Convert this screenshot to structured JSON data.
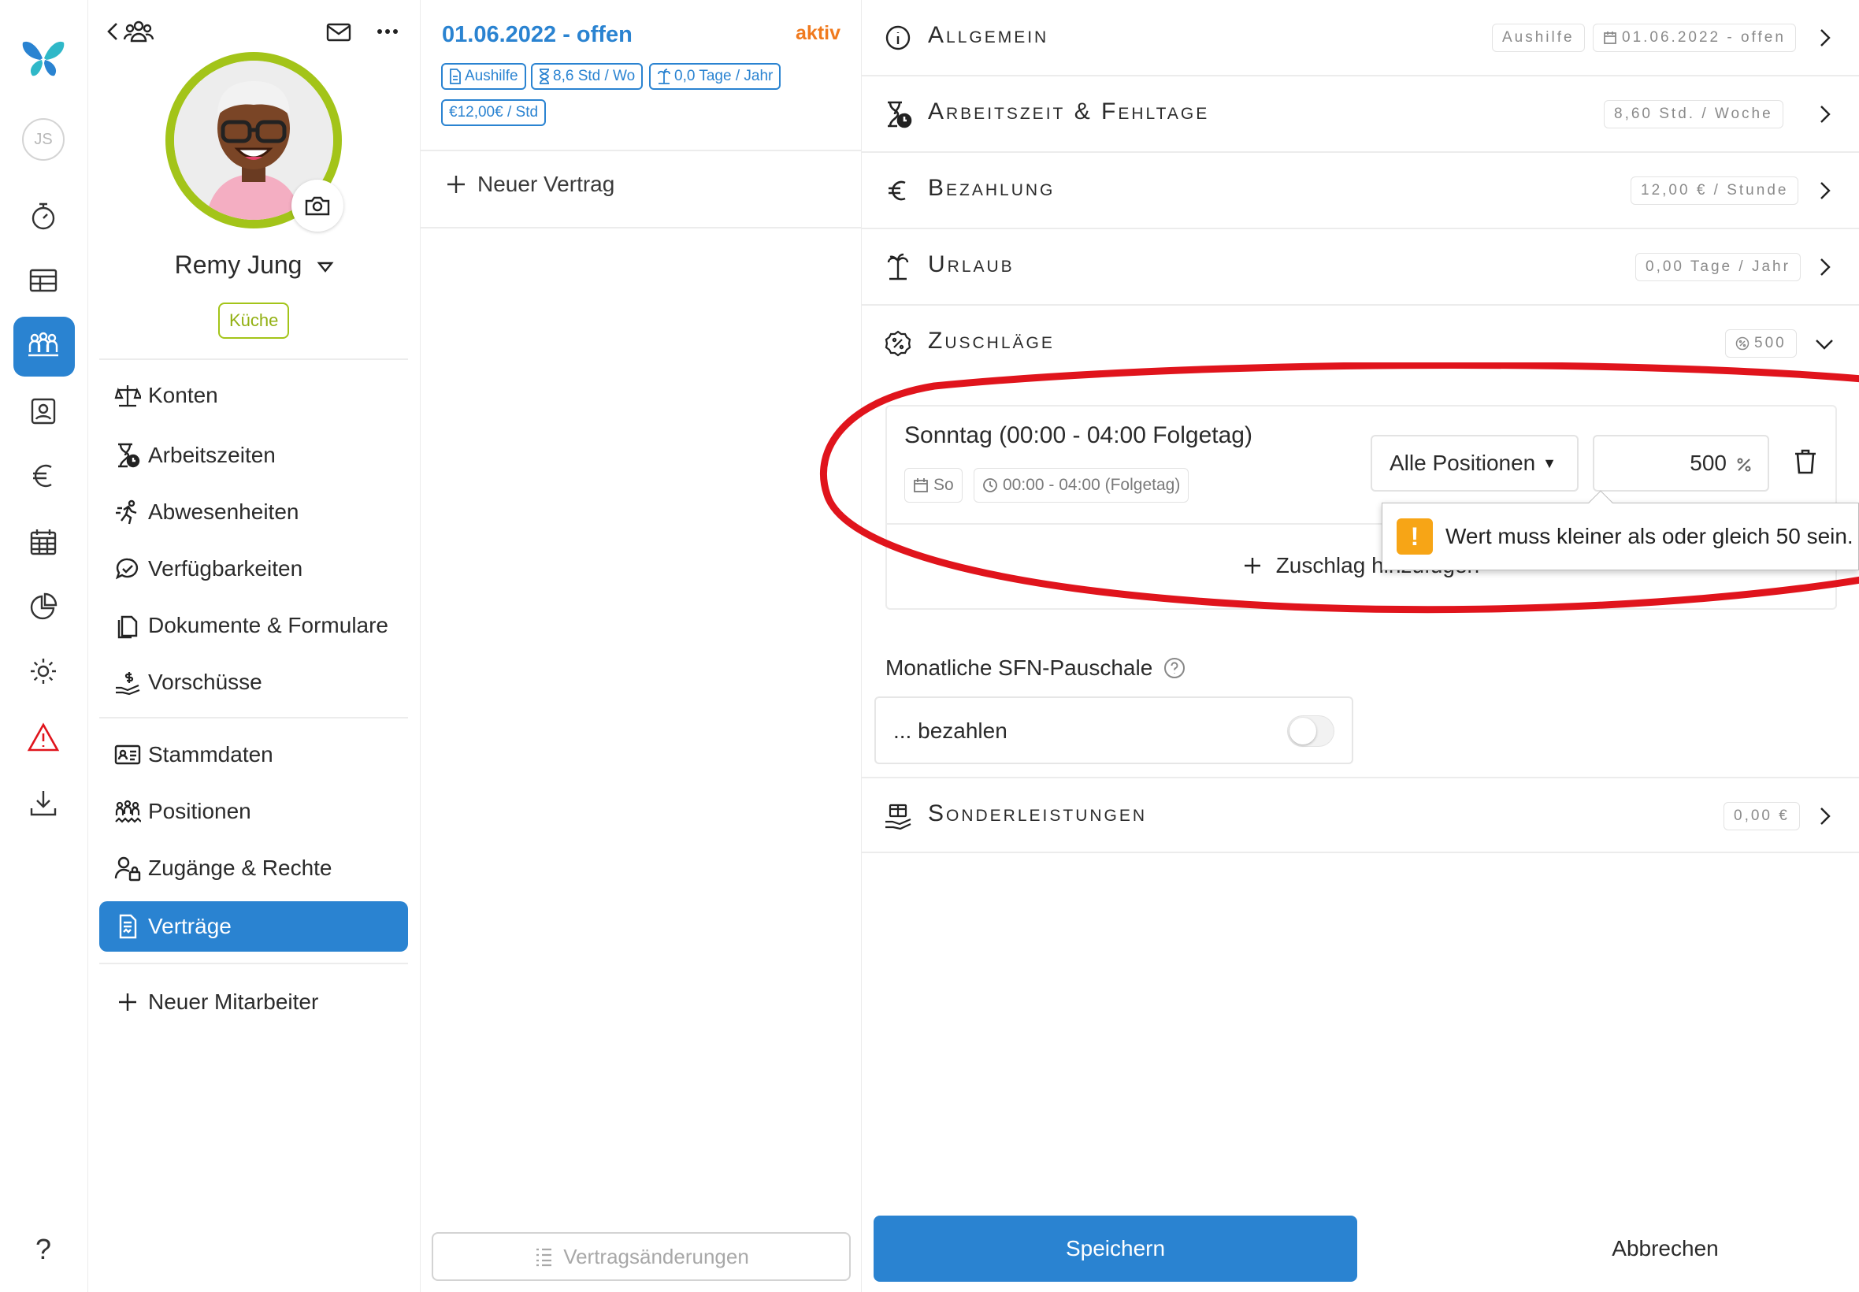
{
  "rail": {
    "user_initials": "JS",
    "help": "?"
  },
  "employee": {
    "name": "Remy Jung",
    "department": "Küche",
    "menu": [
      {
        "label": "Konten"
      },
      {
        "label": "Arbeitszeiten"
      },
      {
        "label": "Abwesenheiten"
      },
      {
        "label": "Verfügbarkeiten"
      },
      {
        "label": "Dokumente & Formulare"
      },
      {
        "label": "Vorschüsse"
      },
      {
        "label": "Stammdaten"
      },
      {
        "label": "Positionen"
      },
      {
        "label": "Zugänge & Rechte"
      },
      {
        "label": "Verträge"
      }
    ],
    "new_employee": "Neuer Mitarbeiter"
  },
  "contract": {
    "date": "01.06.2022 - offen",
    "status": "aktiv",
    "chips": [
      "Aushilfe",
      "8,6 Std / Wo",
      "0,0 Tage / Jahr",
      "€12,00€ / Std"
    ],
    "new_contract": "Neuer Vertrag",
    "changes_button": "Vertragsänderungen"
  },
  "sections": {
    "general": {
      "title": "Allgemein",
      "badge1": "Aushilfe",
      "badge2": "01.06.2022 - offen"
    },
    "worktime": {
      "title": "Arbeitszeit & Fehltage",
      "badge": "8,60 Std. / Woche"
    },
    "payment": {
      "title": "Bezahlung",
      "badge": "12,00 € / Stunde"
    },
    "vacation": {
      "title": "Urlaub",
      "badge": "0,00 Tage / Jahr"
    },
    "surcharges": {
      "title": "Zuschläge",
      "badge": "500"
    },
    "special": {
      "title": "Sonderleistungen",
      "badge": "0,00 €"
    }
  },
  "surcharge": {
    "title": "Sonntag (00:00 - 04:00 Folgetag)",
    "day": "So",
    "time": "00:00 - 04:00 (Folgetag)",
    "position": "Alle Positionen",
    "value": "500",
    "unit": "%",
    "add": "Zuschlag hinzufügen"
  },
  "validation": {
    "message": "Wert muss kleiner als oder gleich 50 sein."
  },
  "sfn": {
    "label": "Monatliche SFN-Pauschale",
    "option": "... bezahlen",
    "enabled": false
  },
  "actions": {
    "save": "Speichern",
    "cancel": "Abbrechen"
  },
  "colors": {
    "accent": "#2a83d1",
    "active_status": "#f07a1e",
    "department": "#a3c419",
    "warning": "#f7a516",
    "annotation": "#e0141c"
  }
}
